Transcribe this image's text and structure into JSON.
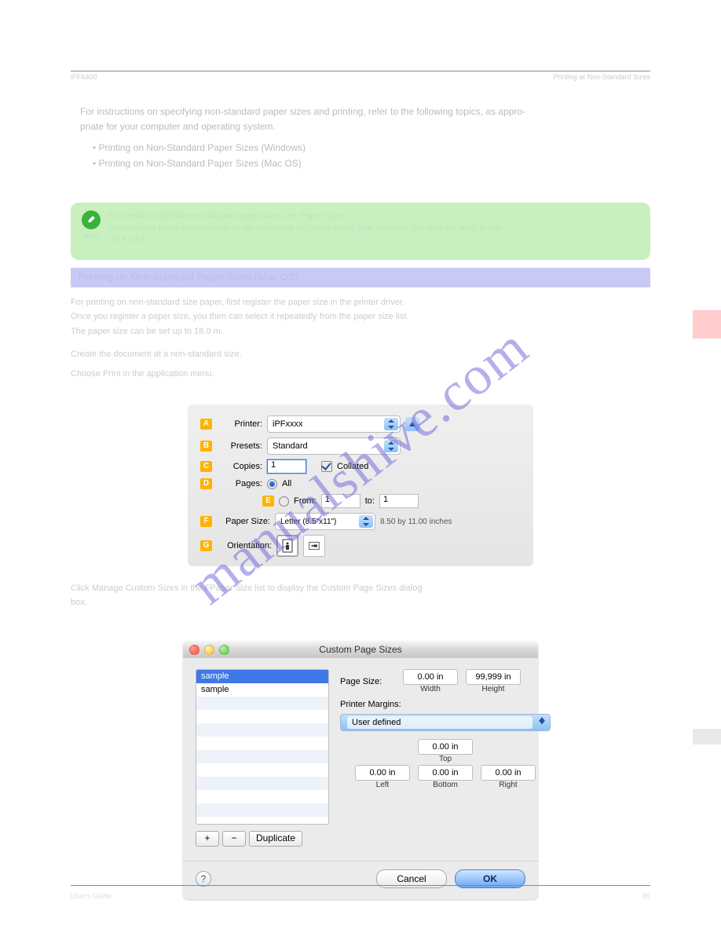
{
  "header": {
    "left": "iPF6400",
    "right": "Printing at Non-Standard Sizes"
  },
  "watermark": "manualshive.com",
  "intro": {
    "line1": "For instructions on specifying non-standard paper sizes and printing, refer to the following topics, as appro-",
    "line2": "priate for your computer and operating system.",
    "b1": "Printing on Non-Standard Paper Sizes (Windows)",
    "b2": "Printing on Non-Standard Paper Sizes (Mac OS)"
  },
  "note": {
    "label": "Note",
    "l1": "For details on printable non-standard paper sizes, see \"Paper Sizes.\"",
    "l2": "Non-standard paper sizes can also be set temporarily in Custom Paper Size. However, this does not apply to Mac",
    "l3": "OS X 10.7."
  },
  "bluebar": "Printing on Non-Standard Paper Sizes (Mac OS)",
  "mid": {
    "l1": "For printing on non-standard size paper, first register the paper size in the printer driver.",
    "l2": "Once you register a paper size, you then can select it repeatedly from the paper size list.",
    "l3": "The paper size can be set up to 18.0 m.",
    "step1": "Create the document at a non-standard size.",
    "step2": "Choose Print in the application menu."
  },
  "panel1": {
    "printer_lbl": "Printer:",
    "printer_val": "iPFxxxx",
    "presets_lbl": "Presets:",
    "presets_val": "Standard",
    "copies_lbl": "Copies:",
    "copies_val": "1",
    "collated_lbl": "Collated",
    "pages_lbl": "Pages:",
    "all_lbl": "All",
    "from_lbl": "From:",
    "from_val": "1",
    "to_lbl": "to:",
    "to_val": "1",
    "size_lbl": "Paper Size:",
    "size_val": "Letter (8.5\"x11\")",
    "dim": "8.50 by 11.00 inches",
    "orient_lbl": "Orientation:"
  },
  "step3": {
    "a": "Click Manage Custom Sizes in the FPaper Size list to display the Custom Page Sizes dialog",
    "b": "box."
  },
  "dialog": {
    "title": "Custom Page Sizes",
    "list": {
      "i1": "sample",
      "i2": "sample"
    },
    "page_size_lbl": "Page Size:",
    "width_lbl": "Width",
    "height_lbl": "Height",
    "w": "0.00 in",
    "h": "99,999 in",
    "margins_lbl": "Printer Margins:",
    "margins_val": "User defined",
    "top_lbl": "Top",
    "left_lbl": "Left",
    "right_lbl": "Right",
    "bottom_lbl": "Bottom",
    "m": "0.00 in",
    "plus": "+",
    "minus": "−",
    "dup": "Duplicate",
    "cancel": "Cancel",
    "ok": "OK",
    "help": "?"
  },
  "footer": {
    "left": "User's Guide",
    "right": "85"
  }
}
